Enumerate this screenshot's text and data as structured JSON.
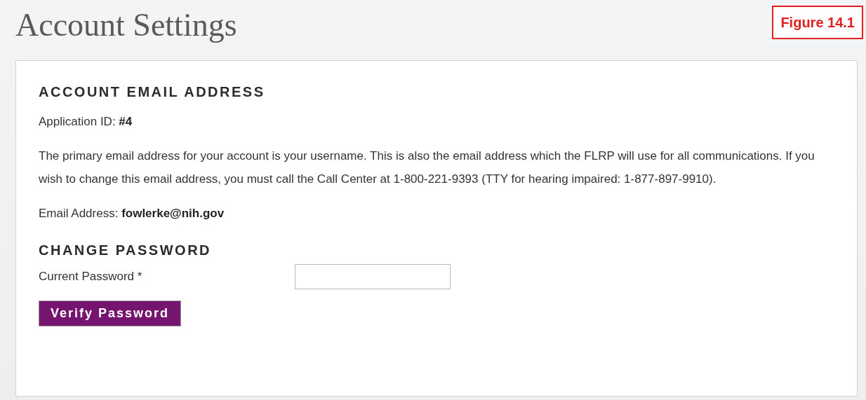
{
  "page_title": "Account Settings",
  "figure_label": "Figure 14.1",
  "email_section": {
    "heading": "ACCOUNT EMAIL ADDRESS",
    "application_id": {
      "label": "Application ID:",
      "value": "#4"
    },
    "description": "The primary email address for your account is your username. This is also the email address which the FLRP will use for all communications. If you wish to change this email address, you must call the Call Center at 1-800-221-9393 (TTY for hearing impaired: 1-877-897-9910).",
    "email": {
      "label": "Email Address:",
      "value": "fowlerke@nih.gov"
    }
  },
  "password_section": {
    "heading": "CHANGE PASSWORD",
    "fields": [
      {
        "label": "Current Password *"
      }
    ],
    "button": "Verify Password"
  }
}
